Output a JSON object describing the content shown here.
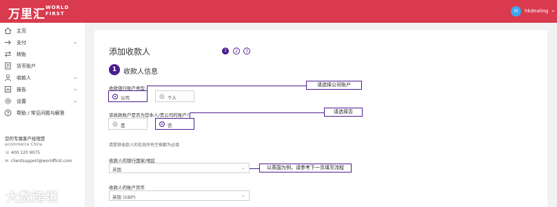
{
  "header": {
    "logo_cn": "万里汇",
    "logo_en_line1": "WORLD",
    "logo_en_line2": "FIRST",
    "avatar_initial": "H",
    "username": "hkdealing"
  },
  "sidebar": {
    "items": [
      {
        "label": "主页",
        "icon": "home-icon",
        "has_chevron": false
      },
      {
        "label": "支付",
        "icon": "arrow-right-icon",
        "has_chevron": true
      },
      {
        "label": "转账",
        "icon": "transfer-icon",
        "has_chevron": false
      },
      {
        "label": "货币账户",
        "icon": "document-icon",
        "has_chevron": false
      },
      {
        "label": "收款人",
        "icon": "user-icon",
        "has_chevron": true
      },
      {
        "label": "报告",
        "icon": "report-icon",
        "has_chevron": true
      },
      {
        "label": "设置",
        "icon": "gear-icon",
        "has_chevron": true
      },
      {
        "label": "帮助 / 常见问题与解答",
        "icon": "help-icon",
        "has_chevron": false
      }
    ],
    "manager_title": "您的专属客户经理是",
    "manager_name": "ecommerce China",
    "manager_phone": "400 120 9075",
    "manager_email": "clientsupport@worldfirst.com"
  },
  "main": {
    "title": "添加收款人",
    "steps": [
      "1",
      "2",
      "3"
    ],
    "section_number": "1",
    "section_title": "收款人信息",
    "account_type_label": "收款银行账户类型",
    "account_type_options": [
      "公司",
      "个人"
    ],
    "own_account_label": "该收款账户是否为您本人/贵公司的账户?",
    "own_account_options": [
      "是",
      "否"
    ],
    "note": "请提供收款人的信息所有空格都为必填",
    "country_label": "收款人的银行国家/地区",
    "country_value": "英国",
    "currency_label": "收款人的账户货币",
    "currency_value": "英镑 (GBP)"
  },
  "annotations": {
    "company_account": "请选择公司账户",
    "choose_no": "请选择否",
    "uk_example": "以英国为例，请参考下一页填写流程"
  },
  "watermark": "大数跨境",
  "colors": {
    "header_red": "#d93a4d",
    "accent_purple": "#4b1c91",
    "avatar_blue": "#3da7f2"
  }
}
